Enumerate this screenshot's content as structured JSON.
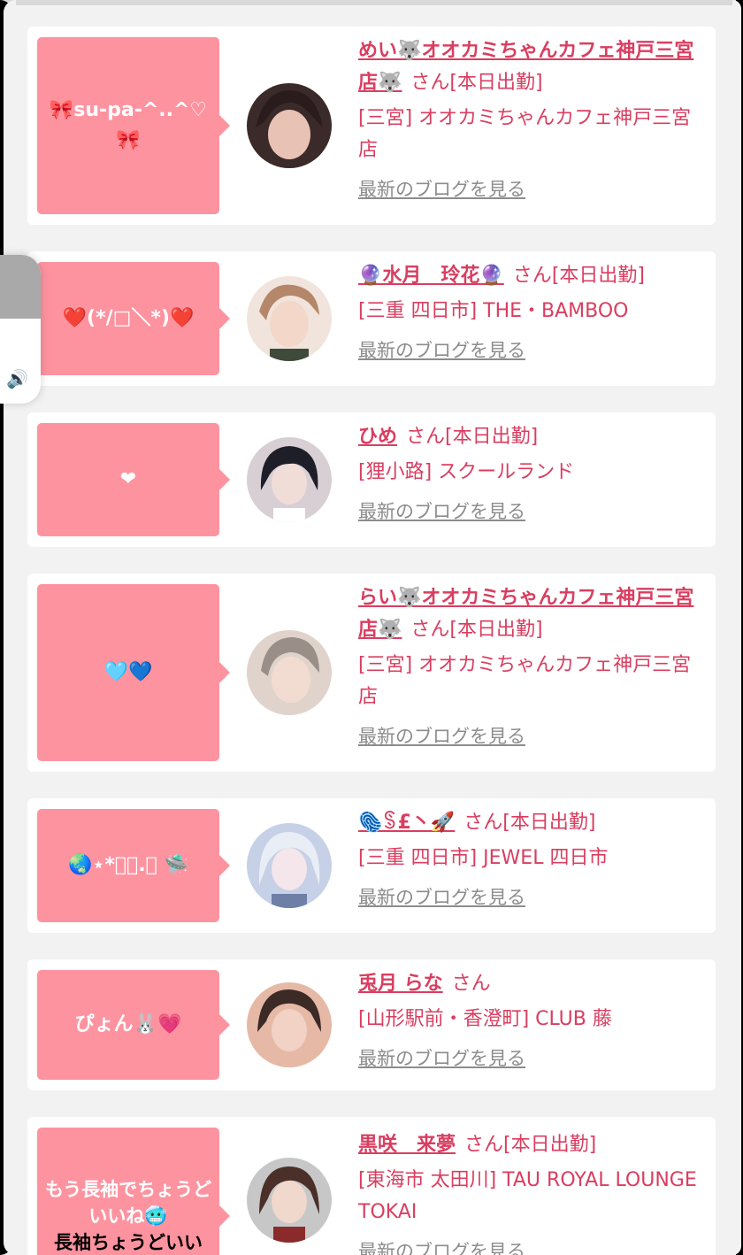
{
  "colors": {
    "accent": "#d93e60",
    "bubble": "#fe93a0",
    "link_gray": "#8c8c8c",
    "background": "#f2f2f2"
  },
  "volume": {
    "icon": "speaker-icon",
    "level": 0.57
  },
  "cards": [
    {
      "bubble_text": "🎀su-pa-^..^♡🎀",
      "name": "めい🐺オオカミちゃんカフェ神戸三宮店🐺",
      "san": "さん",
      "status": "[本日出勤]",
      "shop": "[三宮] オオカミちゃんカフェ神戸三宮店",
      "blog_link": "最新のブログを見る",
      "avatar_colors": [
        "#3a2a2a",
        "#c79a8a"
      ]
    },
    {
      "bubble_text": "❤️(*/□＼*)❤️",
      "name": "🔮水月　玲花🔮",
      "san": "さん",
      "status": "[本日出勤]",
      "shop": "[三重 四日市] THE・BAMBOO",
      "blog_link": "最新のブログを見る",
      "avatar_colors": [
        "#e8c9b8",
        "#b5876a"
      ]
    },
    {
      "bubble_text": "❤",
      "name": "ひめ",
      "san": "さん",
      "status": "[本日出勤]",
      "shop": "[狸小路] スクールランド",
      "blog_link": "最新のブログを見る",
      "avatar_colors": [
        "#1e1e28",
        "#d8cfd4"
      ]
    },
    {
      "bubble_text": "🩵💙",
      "name": "らい🐺オオカミちゃんカフェ神戸三宮店🐺",
      "san": "さん",
      "status": "[本日出勤]",
      "shop": "[三宮] オオカミちゃんカフェ神戸三宮店",
      "blog_link": "最新のブログを見る",
      "avatar_colors": [
        "#9a8f88",
        "#e0d3cc"
      ]
    },
    {
      "bubble_text": "🌏⋆*ﾟ･.｡ 🛸",
      "name": "🫆ꌗ£丶🚀",
      "san": "さん",
      "status": "[本日出勤]",
      "shop": "[三重 四日市] JEWEL 四日市",
      "blog_link": "最新のブログを見る",
      "avatar_colors": [
        "#c6d0e6",
        "#6e7fa6"
      ]
    },
    {
      "bubble_text": "ぴょん🐰💗",
      "name": "兎月 らな",
      "san": "さん",
      "status": "",
      "shop": "[山形駅前・香澄町] CLUB 藤",
      "blog_link": "最新のブログを見る",
      "avatar_colors": [
        "#3b2a25",
        "#e5b9a6"
      ]
    },
    {
      "bubble_text": "もう長袖でちょうどいいね🥶",
      "bubble_text_dark": "長袖ちょうどいい",
      "name": "黒咲　来夢",
      "san": "さん",
      "status": "[本日出勤]",
      "shop": "[東海市 太田川] TAU ROYAL LOUNGE TOKAI",
      "blog_link": "最新のブログを見る",
      "avatar_colors": [
        "#c7c7c7",
        "#8a2a2a"
      ]
    }
  ]
}
